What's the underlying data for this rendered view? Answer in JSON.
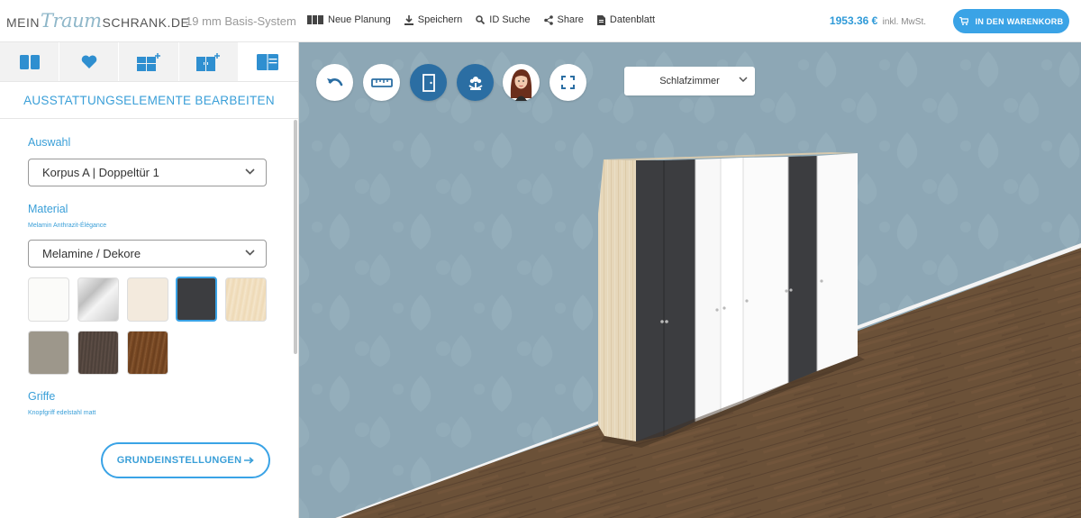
{
  "header": {
    "logo_part1": "MEIN",
    "logo_part2": "Traum",
    "logo_part3": "SCHRANK.DE",
    "subtitle": "19 mm Basis-System",
    "nav": [
      {
        "label": "Neue Planung",
        "icon": "grid-icon"
      },
      {
        "label": "Speichern",
        "icon": "download-icon"
      },
      {
        "label": "ID Suche",
        "icon": "search-icon"
      },
      {
        "label": "Share",
        "icon": "share-icon"
      },
      {
        "label": "Datenblatt",
        "icon": "document-icon"
      }
    ],
    "price": "1953.36 €",
    "vat": "inkl. MwSt.",
    "cart_label": "IN DEN WARENKORB"
  },
  "sidebar": {
    "tabs": [
      {
        "icon": "layout-icon"
      },
      {
        "icon": "heart-icon"
      },
      {
        "icon": "add-element-icon"
      },
      {
        "icon": "add-door-icon"
      },
      {
        "icon": "edit-equipment-icon"
      }
    ],
    "title": "AUSSTATTUNGSELEMENTE BEARBEITEN",
    "selection_label": "Auswahl",
    "selection_value": "Korpus A | Doppeltür 1",
    "material_label": "Material",
    "material_sub": "Melamin Anthrazit-Élégance",
    "material_value": "Melamine / Dekore",
    "swatches": [
      {
        "name": "white",
        "color": "#fbfbf9"
      },
      {
        "name": "mirror",
        "color": "#d9d9d9"
      },
      {
        "name": "cream",
        "color": "#f3eadd"
      },
      {
        "name": "anthracite",
        "color": "#3c3d40",
        "selected": true
      },
      {
        "name": "light-wood",
        "color": "#f0dfc2"
      },
      {
        "name": "taupe",
        "color": "#9d978b"
      },
      {
        "name": "dark-oak",
        "color": "#54473f"
      },
      {
        "name": "walnut",
        "color": "#7a4b28"
      }
    ],
    "handles_label": "Griffe",
    "handles_sub": "Knopfgriff edelstahl matt",
    "basic_settings_label": "GRUNDEINSTELLUNGEN"
  },
  "scene": {
    "room_value": "Schlafzimmer",
    "wall_color": "#8da7b5",
    "floor_color": "#6b5138",
    "cabinet_panels": [
      "anthracite",
      "anthracite",
      "white",
      "white",
      "white",
      "anthracite",
      "white"
    ]
  }
}
